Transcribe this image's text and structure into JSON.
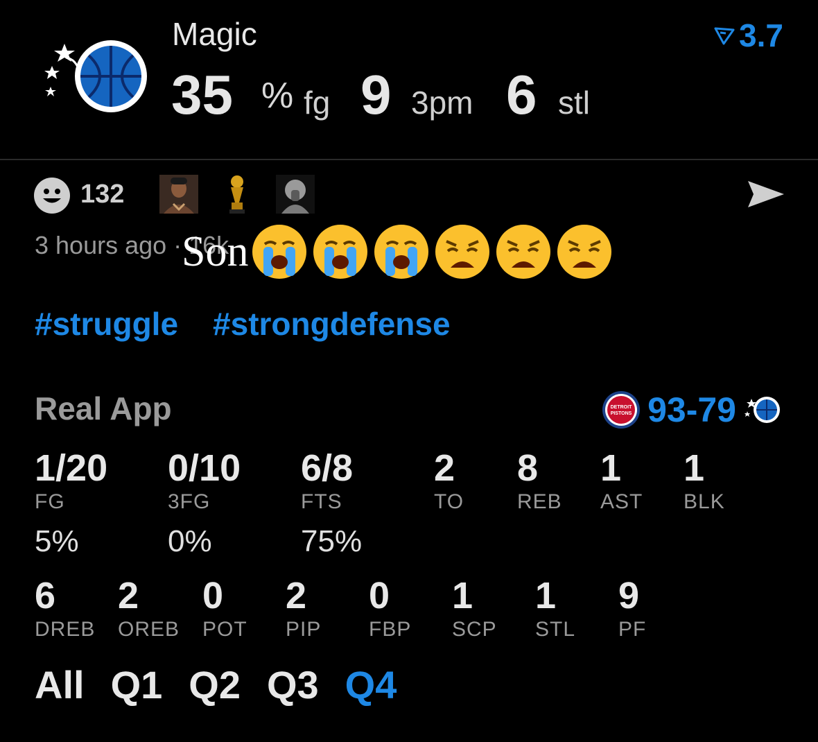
{
  "header": {
    "team_name": "Magic",
    "fg_value": "35",
    "fg_percent_sign": "%",
    "fg_unit": "fg",
    "tpm_value": "9",
    "tpm_unit": "3pm",
    "stl_value": "6",
    "stl_unit": "stl",
    "rating": "3.7"
  },
  "post": {
    "reaction_count": "132",
    "timestamp": "3 hours ago · 16k",
    "caption": "Son",
    "emojis": [
      "loudly-crying",
      "loudly-crying",
      "loudly-crying",
      "weary",
      "weary",
      "weary"
    ],
    "hashtags": [
      "#struggle",
      "#strongdefense"
    ]
  },
  "game": {
    "section_title": "Real App",
    "score": "93-79",
    "stats_row1": [
      {
        "value": "1/20",
        "label": "FG",
        "pct": "5%"
      },
      {
        "value": "0/10",
        "label": "3FG",
        "pct": "0%"
      },
      {
        "value": "6/8",
        "label": "FTS",
        "pct": "75%"
      },
      {
        "value": "2",
        "label": "TO"
      },
      {
        "value": "8",
        "label": "REB"
      },
      {
        "value": "1",
        "label": "AST"
      },
      {
        "value": "1",
        "label": "BLK"
      }
    ],
    "stats_row2": [
      {
        "value": "6",
        "label": "DREB"
      },
      {
        "value": "2",
        "label": "OREB"
      },
      {
        "value": "0",
        "label": "POT"
      },
      {
        "value": "2",
        "label": "PIP"
      },
      {
        "value": "0",
        "label": "FBP"
      },
      {
        "value": "1",
        "label": "SCP"
      },
      {
        "value": "1",
        "label": "STL"
      },
      {
        "value": "9",
        "label": "PF"
      }
    ],
    "tabs": [
      "All",
      "Q1",
      "Q2",
      "Q3",
      "Q4"
    ],
    "active_tab": "Q4",
    "pistons_logo_text": [
      "DETROIT",
      "PISTONS"
    ]
  },
  "colors": {
    "accent": "#1e88e5",
    "background": "#000000",
    "muted": "#9a9a9a"
  }
}
